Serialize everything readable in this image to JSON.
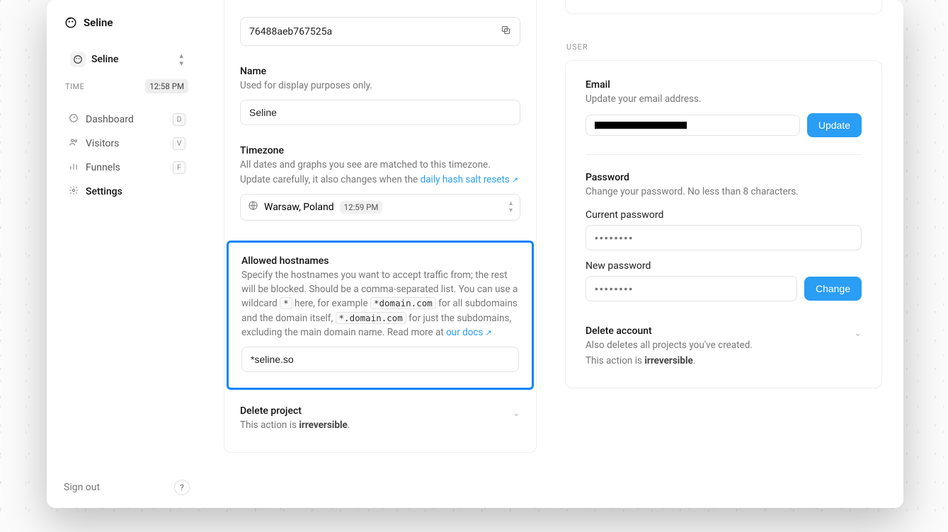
{
  "brand": {
    "name": "Seline"
  },
  "project_switcher": {
    "name": "Seline"
  },
  "sidebar": {
    "time_label": "TIME",
    "time_value": "12:58 PM",
    "items": [
      {
        "label": "Dashboard",
        "kbd": "D"
      },
      {
        "label": "Visitors",
        "kbd": "V"
      },
      {
        "label": "Funnels",
        "kbd": "F"
      },
      {
        "label": "Settings",
        "kbd": ""
      }
    ],
    "signout": "Sign out",
    "help": "?"
  },
  "settings": {
    "token": "76488aeb767525a",
    "name": {
      "label": "Name",
      "desc": "Used for display purposes only.",
      "value": "Seline"
    },
    "timezone": {
      "label": "Timezone",
      "desc1": "All dates and graphs you see are matched to this timezone. Update carefully, it also changes when the ",
      "link": "daily hash salt resets",
      "value": "Warsaw, Poland",
      "time": "12:59 PM"
    },
    "allowed": {
      "label": "Allowed hostnames",
      "desc_a": "Specify the hostnames you want to accept traffic from; the rest will be blocked. Should be a comma-separated list. You can use a wildcard ",
      "code1": "*",
      "desc_b": " here, for example ",
      "code2": "*domain.com",
      "desc_c": " for all subdomains and the domain itself, ",
      "code3": "*.domain.com",
      "desc_d": " for just the subdomains, excluding the main domain name. Read more at ",
      "docs_link": "our docs",
      "value": "*seline.so"
    },
    "delete": {
      "label": "Delete project",
      "desc_a": "This action is ",
      "irrev": "irreversible",
      "dot": "."
    }
  },
  "user": {
    "heading": "USER",
    "email": {
      "label": "Email",
      "desc": "Update your email address.",
      "button": "Update"
    },
    "password": {
      "label": "Password",
      "desc": "Change your password. No less than 8 characters.",
      "current_label": "Current password",
      "new_label": "New password",
      "placeholder": "••••••••",
      "button": "Change"
    },
    "delete": {
      "label": "Delete account",
      "desc1": "Also deletes all projects you've created.",
      "desc_a": "This action is ",
      "irrev": "irreversible",
      "dot": "."
    }
  }
}
